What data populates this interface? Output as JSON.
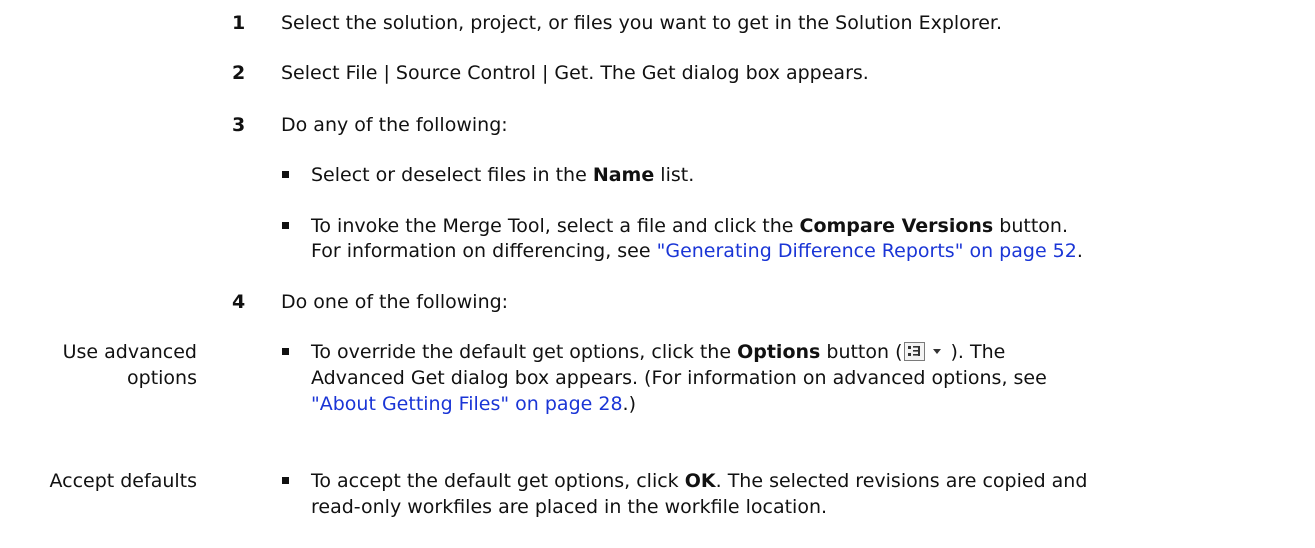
{
  "steps": [
    {
      "number": "1",
      "text": "Select the solution, project, or files you want to get in the Solution Explorer."
    },
    {
      "number": "2",
      "text": "Select File | Source Control | Get. The Get dialog box appears."
    },
    {
      "number": "3",
      "text": "Do any of the following:"
    },
    {
      "number": "4",
      "text": "Do one of the following:"
    }
  ],
  "step3_bullets": {
    "b1": {
      "before": "Select or deselect files in the ",
      "bold": "Name",
      "after": " list."
    },
    "b2": {
      "before": "To invoke the Merge Tool, select a file and click the ",
      "bold": "Compare Versions",
      "after": " button.",
      "line2_before": "For information on differencing, see ",
      "link": "\"Generating Difference Reports\" on page 52",
      "line2_after": "."
    }
  },
  "step4_options": {
    "advanced": {
      "margin_label_1": "Use advanced",
      "margin_label_2": "options",
      "before": "To override the default get options, click the ",
      "bold": "Options",
      "after_bold": " button (",
      "icon_name": "options-dropdown-icon",
      "after_icon": "). The",
      "line2": "Advanced Get dialog box appears. (For information on advanced options, see",
      "link": "\"About Getting Files\" on page 28",
      "line3_after": ".)"
    },
    "defaults": {
      "margin_label": "Accept defaults",
      "before": "To accept the default get options, click ",
      "bold": "OK",
      "after": ". The selected revisions are copied and",
      "line2": "read-only workfiles are placed in the workfile location."
    }
  }
}
